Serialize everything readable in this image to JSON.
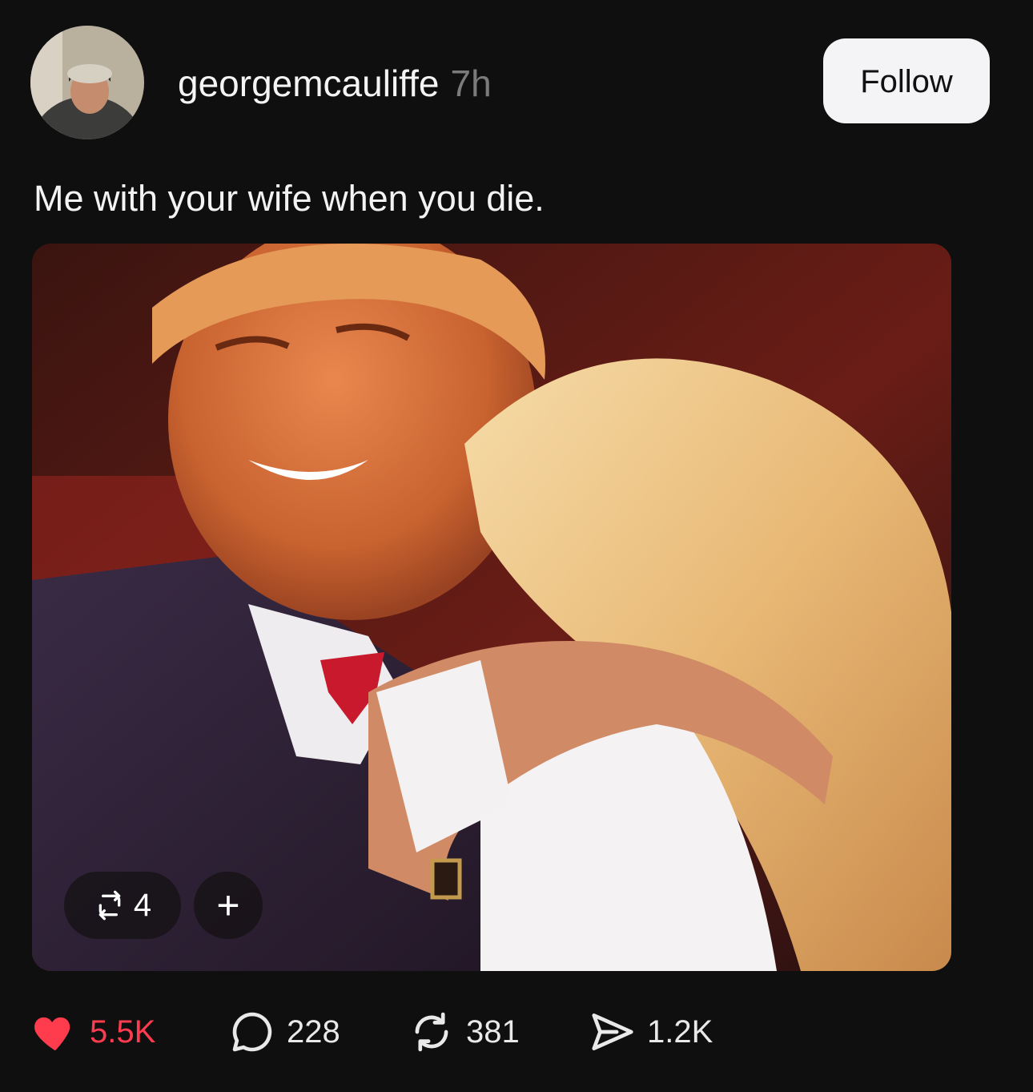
{
  "post": {
    "username": "georgemcauliffe",
    "timestamp": "7h",
    "follow_label": "Follow",
    "caption": "Me with your wife when you die.",
    "media": {
      "repost_count": "4",
      "add_label": "+"
    },
    "actions": {
      "likes": "5.5K",
      "comments": "228",
      "reposts": "381",
      "shares": "1.2K"
    },
    "colors": {
      "background": "#0f0f10",
      "like_active": "#ff3b4e",
      "follow_bg": "#f4f4f6",
      "muted_text": "#7b7b7b"
    },
    "icons": {
      "like": "heart-icon",
      "comment": "comment-bubble-icon",
      "repost": "repost-arrows-icon",
      "share": "send-icon"
    }
  }
}
